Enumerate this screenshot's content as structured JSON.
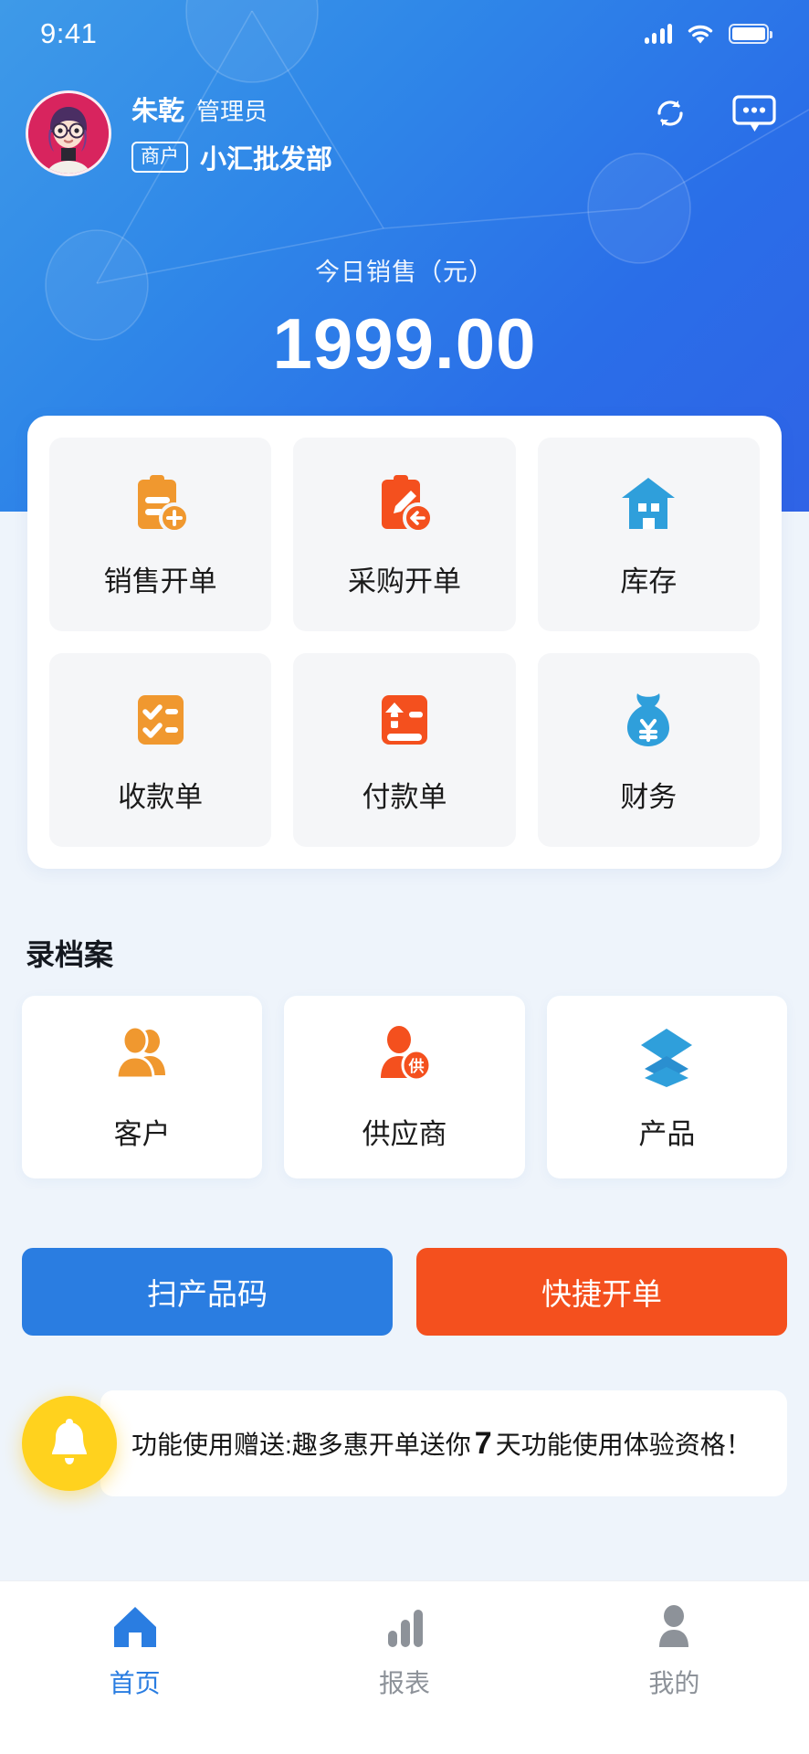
{
  "status_bar": {
    "time": "9:41",
    "signal_icon": "signal-bars-icon",
    "wifi_icon": "wifi-icon",
    "battery_icon": "battery-icon"
  },
  "header": {
    "user_name": "朱乾",
    "user_role": "管理员",
    "merchant_badge": "商户",
    "shop_name": "小汇批发部",
    "sync_icon": "sync-icon",
    "message_icon": "message-bubble-icon",
    "sales_label": "今日销售（元）",
    "sales_value": "1999.00",
    "gradient_from": "#3e9ae8",
    "gradient_to": "#2f63e6"
  },
  "quick_grid": [
    {
      "label": "销售开单",
      "icon": "clipboard-add-icon",
      "color": "#f0982f"
    },
    {
      "label": "采购开单",
      "icon": "clipboard-edit-return-icon",
      "color": "#f4501e"
    },
    {
      "label": "库存",
      "icon": "warehouse-house-icon",
      "color": "#2f9fdb"
    },
    {
      "label": "收款单",
      "icon": "receipt-check-icon",
      "color": "#f0982f"
    },
    {
      "label": "付款单",
      "icon": "payment-yuan-icon",
      "color": "#f4501e"
    },
    {
      "label": "财务",
      "icon": "money-bag-yuan-icon",
      "color": "#2f9fdb"
    }
  ],
  "archive": {
    "title": "录档案",
    "items": [
      {
        "label": "客户",
        "icon": "customers-people-icon",
        "color": "#f0982f"
      },
      {
        "label": "供应商",
        "icon": "supplier-person-icon",
        "color": "#f4501e"
      },
      {
        "label": "产品",
        "icon": "product-layers-icon",
        "color": "#2f9fdb"
      }
    ]
  },
  "actions": {
    "scan_label": "扫产品码",
    "scan_color": "#2a7de1",
    "quick_bill_label": "快捷开单",
    "quick_bill_color": "#f4501e"
  },
  "notice": {
    "bell_icon": "bell-icon",
    "bell_color": "#ffd21e",
    "text_part1": "功能使用赠送:趣多惠开单送你",
    "highlight": "7",
    "text_part2": "天功能使用体验资格！"
  },
  "tabbar": {
    "active_color": "#2a7de1",
    "inactive_color": "#8d9299",
    "items": [
      {
        "label": "首页",
        "icon": "home-icon",
        "active": true
      },
      {
        "label": "报表",
        "icon": "bar-chart-icon",
        "active": false
      },
      {
        "label": "我的",
        "icon": "person-icon",
        "active": false
      }
    ]
  }
}
